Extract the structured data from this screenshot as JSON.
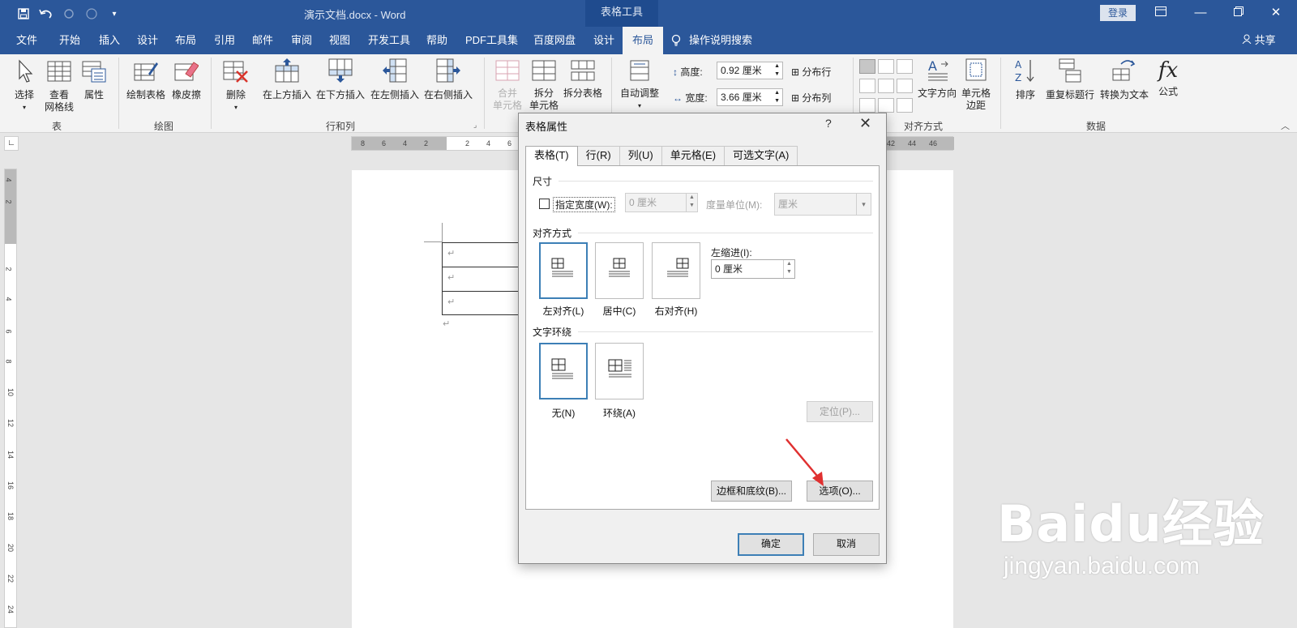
{
  "titlebar": {
    "doc_title": "演示文档.docx  -  Word",
    "context_tab": "表格工具",
    "login": "登录"
  },
  "tabs": [
    "文件",
    "开始",
    "插入",
    "设计",
    "布局",
    "引用",
    "邮件",
    "审阅",
    "视图",
    "开发工具",
    "帮助",
    "PDF工具集",
    "百度网盘",
    "设计",
    "布局"
  ],
  "tell_me": "操作说明搜索",
  "share": "共享",
  "ribbon": {
    "group_table": {
      "label": "表",
      "select": "选择",
      "gridlines_1": "查看",
      "gridlines_2": "网格线",
      "properties": "属性"
    },
    "group_draw": {
      "label": "绘图",
      "draw": "绘制表格",
      "eraser": "橡皮擦"
    },
    "group_rows": {
      "label": "行和列",
      "delete": "删除",
      "above": "在上方插入",
      "below": "在下方插入",
      "left": "在左侧插入",
      "right": "在右侧插入"
    },
    "group_merge": {
      "merge_1": "合并",
      "merge_2": "单元格",
      "split_1": "拆分",
      "split_2": "单元格",
      "split_table": "拆分表格"
    },
    "group_size": {
      "autofit": "自动调整",
      "height_label": "高度:",
      "height_value": "0.92 厘米",
      "width_label": "宽度:",
      "width_value": "3.66 厘米",
      "dist_rows": "分布行",
      "dist_cols": "分布列"
    },
    "group_align": {
      "label": "对齐方式",
      "text_dir": "文字方向",
      "margins_1": "单元格",
      "margins_2": "边距"
    },
    "group_data": {
      "label": "数据",
      "sort": "排序",
      "repeat_header": "重复标题行",
      "to_text": "转换为文本",
      "formula": "公式"
    }
  },
  "ruler": {
    "h_numbers": [
      "8",
      "6",
      "4",
      "2",
      "",
      "2",
      "4",
      "6",
      "42",
      "44",
      "46"
    ],
    "v_numbers": [
      "4",
      "2",
      "",
      "2",
      "4",
      "6",
      "8",
      "10",
      "12",
      "14",
      "16",
      "18",
      "20",
      "22",
      "24"
    ]
  },
  "dialog": {
    "title": "表格属性",
    "help": "?",
    "tabs": [
      "表格(T)",
      "行(R)",
      "列(U)",
      "单元格(E)",
      "可选文字(A)"
    ],
    "size_section": "尺寸",
    "specify_width": "指定宽度(W):",
    "width_value": "0 厘米",
    "measure_in": "度量单位(M):",
    "measure_value": "厘米",
    "alignment_section": "对齐方式",
    "align_left": "左对齐(L)",
    "align_center": "居中(C)",
    "align_right": "右对齐(H)",
    "indent_label": "左缩进(I):",
    "indent_value": "0 厘米",
    "wrap_section": "文字环绕",
    "wrap_none": "无(N)",
    "wrap_around": "环绕(A)",
    "position_btn": "定位(P)...",
    "borders_btn": "边框和底纹(B)...",
    "options_btn": "选项(O)...",
    "ok_btn": "确定",
    "cancel_btn": "取消"
  },
  "watermark": {
    "logo": "Baidu经验",
    "url": "jingyan.baidu.com"
  },
  "colors": {
    "word_blue": "#2b579a",
    "accent": "#3d7fb6",
    "arrow_red": "#e03030"
  }
}
